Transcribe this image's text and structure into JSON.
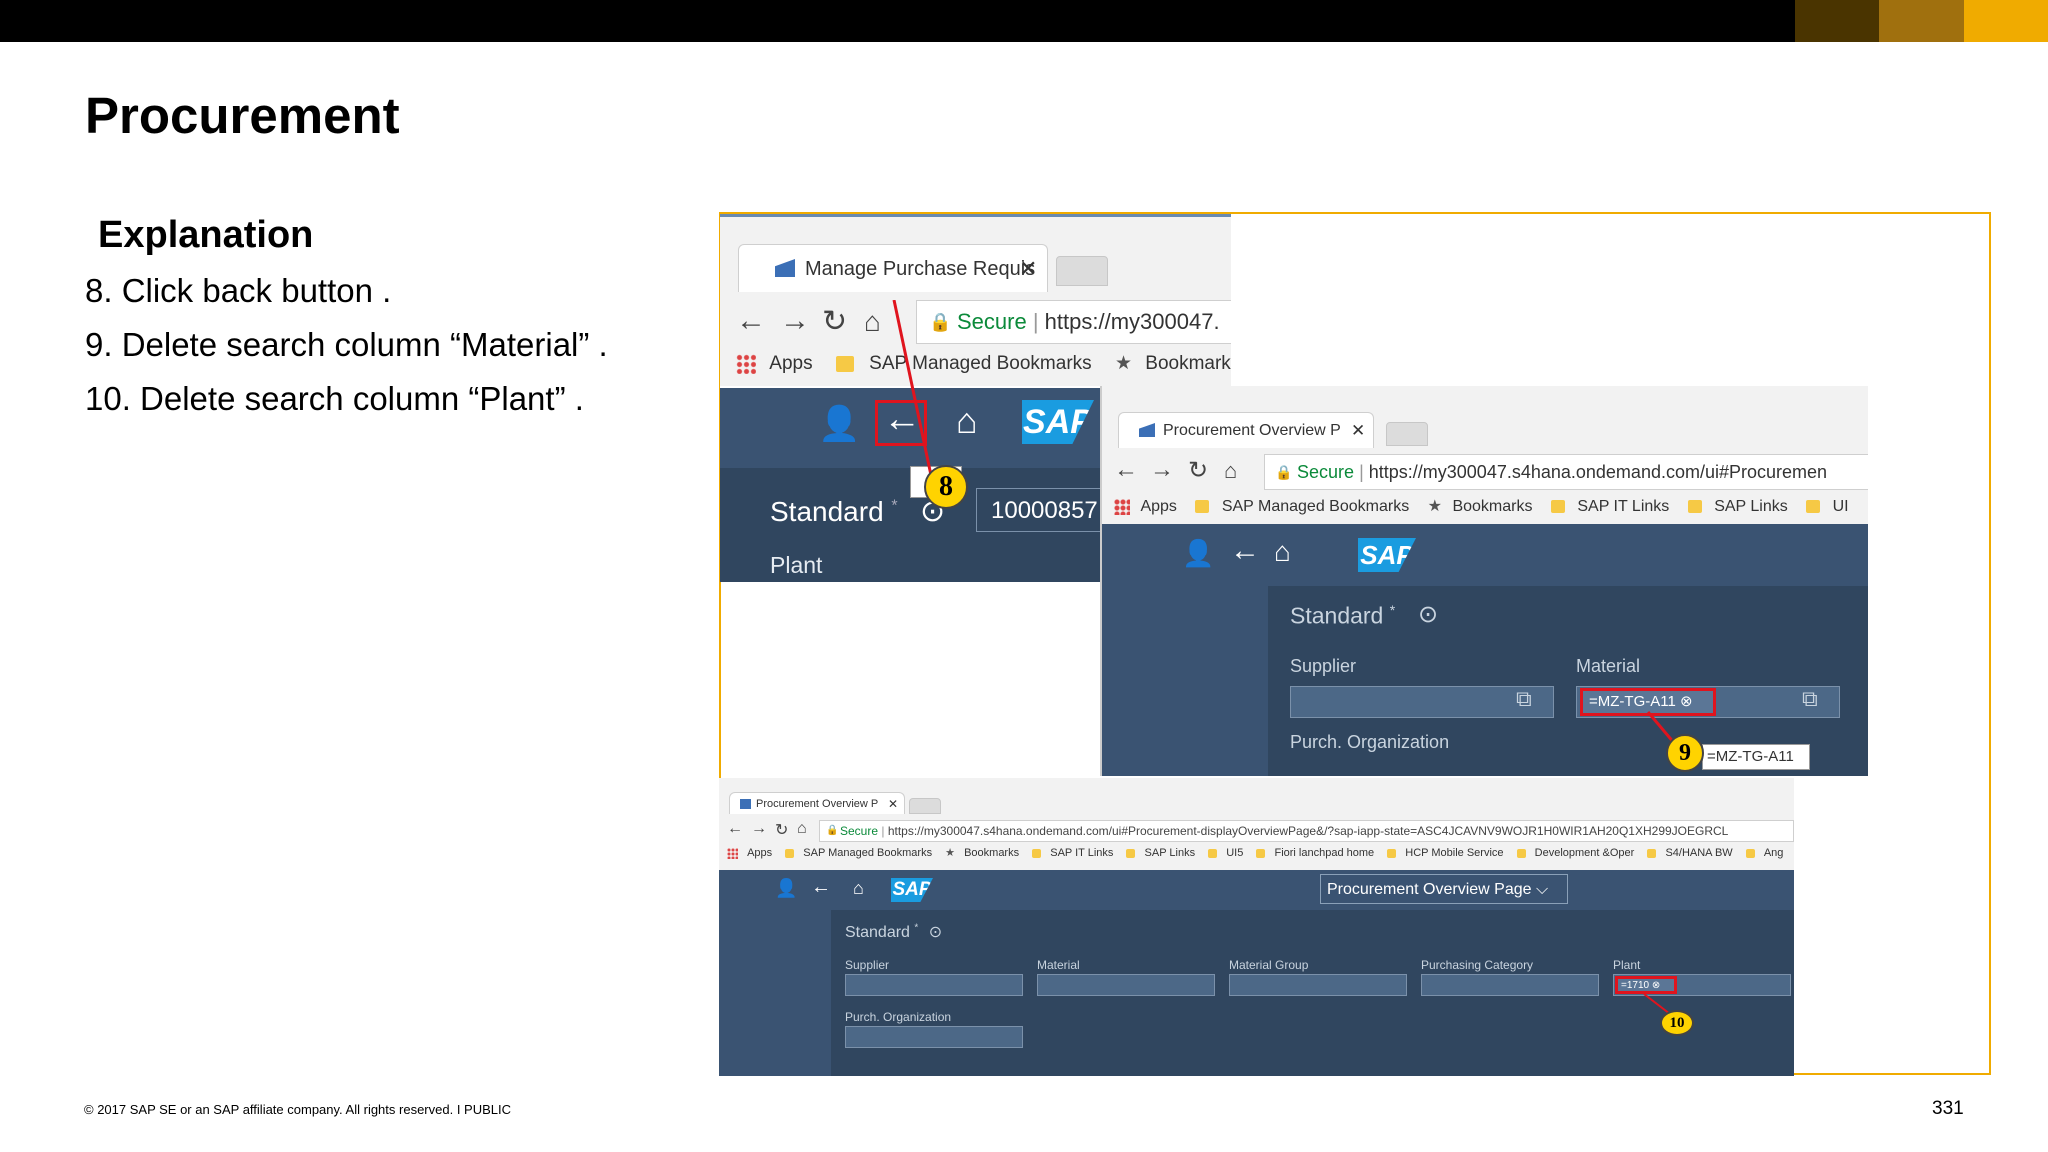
{
  "slide": {
    "title": "Procurement",
    "explanation_heading": "Explanation",
    "steps": [
      "8. Click back button .",
      "9. Delete search column “Material” .",
      "10. Delete search column “Plant” ."
    ],
    "footer": "© 2017 SAP SE or an SAP affiliate company. All rights reserved.   I   PUBLIC",
    "page_number": "331",
    "accent_colors": [
      "#000000",
      "#4a3400",
      "#a0700e",
      "#f0ab00"
    ]
  },
  "shot1": {
    "tab_title": "Manage Purchase Requis",
    "secure": "Secure",
    "url": "https://my300047.",
    "bookmarks": [
      "Apps",
      "SAP Managed Bookmarks",
      "Bookmark"
    ],
    "sap_logo": "SAP",
    "variant": "Standard",
    "variant_star": "*",
    "number_value": "10000857",
    "plant_label": "Plant",
    "callout": "8",
    "icons": [
      "user-icon",
      "back-arrow-icon",
      "home-icon"
    ]
  },
  "shot2": {
    "tab_title": "Procurement Overview P",
    "secure": "Secure",
    "url": "https://my300047.s4hana.ondemand.com/ui#Procuremen",
    "bookmarks": [
      "Apps",
      "SAP Managed Bookmarks",
      "Bookmarks",
      "SAP IT Links",
      "SAP Links",
      "UI"
    ],
    "sap_logo": "SAP",
    "variant": "Standard",
    "variant_star": "*",
    "supplier_label": "Supplier",
    "material_label": "Material",
    "material_token": "=MZ-TG-A11",
    "purch_org_label": "Purch. Organization",
    "tooltip": "=MZ-TG-A11",
    "callout": "9"
  },
  "shot3": {
    "tab_title": "Procurement Overview P",
    "secure": "Secure",
    "url": "https://my300047.s4hana.ondemand.com/ui#Procurement-displayOverviewPage&/?sap-iapp-state=ASC4JCAVNV9WOJR1H0WIR1AH20Q1XH299JOEGRCL",
    "bookmarks": [
      "Apps",
      "SAP Managed Bookmarks",
      "Bookmarks",
      "SAP IT Links",
      "SAP Links",
      "UI5",
      "Fiori lanchpad home",
      "HCP Mobile Service",
      "Development &Oper",
      "S4/HANA BW",
      "Ang"
    ],
    "sap_logo": "SAP",
    "page_selector": "Procurement Overview Page",
    "variant": "Standard",
    "variant_star": "*",
    "filters": [
      "Supplier",
      "Material",
      "Material Group",
      "Purchasing Category",
      "Plant"
    ],
    "plant_token": "=1710",
    "purch_org_label": "Purch. Organization",
    "callout": "10"
  }
}
